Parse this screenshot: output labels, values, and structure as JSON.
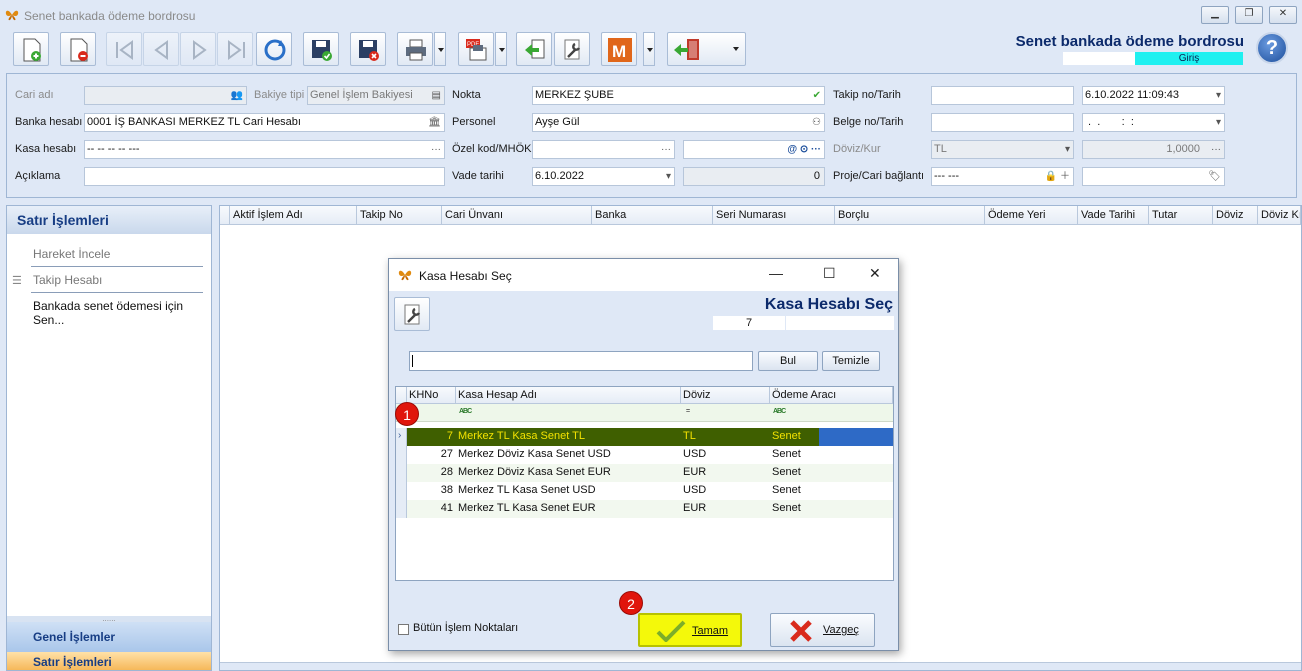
{
  "window": {
    "title": "Senet bankada ödeme bordrosu",
    "controls": [
      "minimize",
      "restore",
      "close"
    ]
  },
  "toolbar": {
    "form_title": "Senet bankada ödeme bordrosu",
    "mode": "Giriş",
    "buttons": [
      "new-record",
      "delete-record",
      "first",
      "previous",
      "next",
      "last",
      "refresh",
      "save",
      "save-close",
      "print",
      "pdf-export",
      "back",
      "tools",
      "m-module",
      "exit"
    ]
  },
  "form": {
    "cari_adi_label": "Cari adı",
    "cari_adi_value": "",
    "bakiye_tipi_label": "Bakiye tipi",
    "bakiye_tipi_value": "Genel İşlem Bakiyesi",
    "nokta_label": "Nokta",
    "nokta_value": "MERKEZ ŞUBE",
    "takip_label": "Takip no/Tarih",
    "takip_no": "",
    "takip_tarih": "6.10.2022 11:09:43",
    "banka_label": "Banka hesabı",
    "banka_value": "0001 İŞ BANKASI MERKEZ TL Cari Hesabı",
    "personel_label": "Personel",
    "personel_value": "Ayşe Gül",
    "belge_label": "Belge no/Tarih",
    "belge_no": "",
    "belge_tarih": " .  .       :  :",
    "kasa_label": "Kasa hesabı",
    "kasa_value": "-- -- -- -- ---",
    "ozel_label": "Özel kod/MHÖK",
    "ozel_value": "",
    "ozel_value2": "",
    "doviz_label": "Döviz/Kur",
    "doviz_value": "TL",
    "kur_value": "1,0000",
    "aciklama_label": "Açıklama",
    "aciklama_value": "",
    "vade_label": "Vade tarihi",
    "vade_value": "6.10.2022",
    "vade_num": "0",
    "proje_label": "Proje/Cari bağlantı",
    "proje_value": "--- ---",
    "proje_value2": ""
  },
  "sidebar": {
    "title": "Satır İşlemleri",
    "items": [
      {
        "label": "Hareket İncele"
      },
      {
        "label": "Takip Hesabı"
      },
      {
        "label": "Bankada senet ödemesi için Sen..."
      }
    ],
    "grip": "......",
    "bottom1": "Genel İşlemler",
    "bottom2": "Satır İşlemleri"
  },
  "grid": {
    "columns": [
      "Aktif İşlem Adı",
      "Takip No",
      "Cari Ünvanı",
      "Banka",
      "Seri Numarası",
      "Borçlu",
      "Ödeme Yeri",
      "Vade Tarihi",
      "Tutar",
      "Döviz",
      "Döviz Kı"
    ]
  },
  "dialog": {
    "title": "Kasa Hesabı Seç",
    "heading": "Kasa Hesabı Seç",
    "count": "7",
    "search_value": "",
    "bul_label": "Bul",
    "temizle_label": "Temizle",
    "columns": [
      "KHNo",
      "Kasa Hesap Adı",
      "Döviz",
      "Ödeme Aracı"
    ],
    "filter_icons": [
      "ABC",
      "=",
      "ABC"
    ],
    "rows": [
      {
        "no": "7",
        "name": "Merkez TL Kasa Senet TL",
        "doviz": "TL",
        "arac": "Senet",
        "selected": true
      },
      {
        "no": "27",
        "name": "Merkez Döviz Kasa Senet USD",
        "doviz": "USD",
        "arac": "Senet"
      },
      {
        "no": "28",
        "name": "Merkez Döviz Kasa Senet EUR",
        "doviz": "EUR",
        "arac": "Senet"
      },
      {
        "no": "38",
        "name": "Merkez TL Kasa Senet USD",
        "doviz": "USD",
        "arac": "Senet"
      },
      {
        "no": "41",
        "name": "Merkez TL Kasa Senet EUR",
        "doviz": "EUR",
        "arac": "Senet"
      }
    ],
    "checkbox_label": "Bütün İşlem Noktaları",
    "tamam_label": "Tamam",
    "vazgec_label": "Vazgeç"
  },
  "annotations": [
    {
      "label": "1"
    },
    {
      "label": "2"
    }
  ],
  "colors": {
    "selected_row_bg": "#3f5f00",
    "selected_row_fg": "#f3e200",
    "mode_badge": "#1ff0f0",
    "annotation_badge": "#e0150c",
    "title_blue": "#0c2a6b"
  }
}
